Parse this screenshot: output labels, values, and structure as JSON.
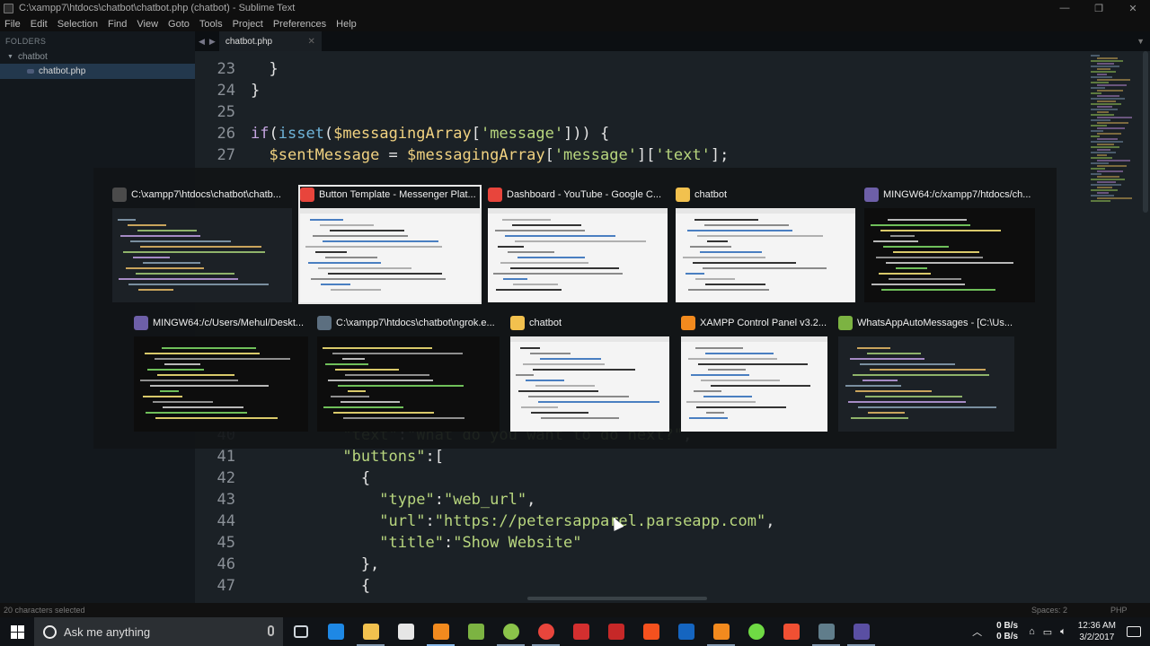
{
  "window": {
    "title": "C:\\xampp7\\htdocs\\chatbot\\chatbot.php (chatbot) - Sublime Text",
    "controls": [
      "—",
      "❐",
      "✕"
    ]
  },
  "menu": [
    "File",
    "Edit",
    "Selection",
    "Find",
    "View",
    "Goto",
    "Tools",
    "Project",
    "Preferences",
    "Help"
  ],
  "sidebar": {
    "heading": "FOLDERS",
    "folder": "chatbot",
    "file": "chatbot.php"
  },
  "tabs": [
    {
      "label": "chatbot.php",
      "close": "✕"
    }
  ],
  "editor": {
    "lines": [
      {
        "n": "23",
        "code": "  }"
      },
      {
        "n": "24",
        "code": "}"
      },
      {
        "n": "25",
        "code": ""
      },
      {
        "n": "26",
        "code": "if(isset($messagingArray['message'])) {"
      },
      {
        "n": "27",
        "code": "  $sentMessage = $messagingArray['message']['text'];"
      },
      {
        "n": "40",
        "code": "          \"text\":\"What do you want to do next?\","
      },
      {
        "n": "41",
        "code": "          \"buttons\":["
      },
      {
        "n": "42",
        "code": "            {"
      },
      {
        "n": "43",
        "code": "              \"type\":\"web_url\","
      },
      {
        "n": "44",
        "code": "              \"url\":\"https://petersapparel.parseapp.com\","
      },
      {
        "n": "45",
        "code": "              \"title\":\"Show Website\""
      },
      {
        "n": "46",
        "code": "            },"
      },
      {
        "n": "47",
        "code": "            {"
      }
    ]
  },
  "status": {
    "selection": "20 characters selected",
    "indent": "Spaces: 2",
    "syntax": "PHP"
  },
  "switcher": {
    "windows": [
      {
        "title": "C:\\xampp7\\htdocs\\chatbot\\chatb...",
        "icon": "sublime-icon",
        "color": "#4b4b4b",
        "kind": "dark",
        "selected": false
      },
      {
        "title": "Button Template - Messenger Plat...",
        "icon": "chrome-icon",
        "color": "#e8453c",
        "kind": "light",
        "selected": true
      },
      {
        "title": "Dashboard - YouTube - Google C...",
        "icon": "chrome-icon",
        "color": "#e8453c",
        "kind": "light",
        "selected": false
      },
      {
        "title": "chatbot",
        "icon": "folder-icon",
        "color": "#f2c14e",
        "kind": "light",
        "selected": false
      },
      {
        "title": "MINGW64:/c/xampp7/htdocs/ch...",
        "icon": "git-bash-icon",
        "color": "#6d5fa8",
        "kind": "term",
        "selected": false
      },
      {
        "title": "MINGW64:/c/Users/Mehul/Deskt...",
        "icon": "git-bash-icon",
        "color": "#6d5fa8",
        "kind": "term",
        "selected": false
      },
      {
        "title": "C:\\xampp7\\htdocs\\chatbot\\ngrok.e...",
        "icon": "console-icon",
        "color": "#5c6f80",
        "kind": "term",
        "selected": false
      },
      {
        "title": "chatbot",
        "icon": "folder-icon",
        "color": "#f2c14e",
        "kind": "light",
        "selected": false
      },
      {
        "title": "XAMPP Control Panel v3.2...",
        "icon": "xampp-icon",
        "color": "#f28a1e",
        "kind": "light",
        "selected": false
      },
      {
        "title": "WhatsAppAutoMessages - [C:\\Us...",
        "icon": "android-studio-icon",
        "color": "#7cb342",
        "kind": "dark",
        "selected": false
      }
    ]
  },
  "taskbar": {
    "search_placeholder": "Ask me anything",
    "apps": [
      {
        "name": "task-view-icon",
        "color": "#cfd6dc",
        "state": ""
      },
      {
        "name": "edge-icon",
        "color": "#1e88e5",
        "state": ""
      },
      {
        "name": "file-explorer-icon",
        "color": "#f2c14e",
        "state": "open"
      },
      {
        "name": "store-icon",
        "color": "#e6e6e6",
        "state": ""
      },
      {
        "name": "sublime-text-icon",
        "color": "#f28a1e",
        "state": "active"
      },
      {
        "name": "notepad-icon",
        "color": "#7cb342",
        "state": ""
      },
      {
        "name": "android-icon",
        "color": "#8bc34a",
        "state": "open"
      },
      {
        "name": "chrome-icon",
        "color": "#e8453c",
        "state": "open"
      },
      {
        "name": "acrobat-icon",
        "color": "#d32f2f",
        "state": ""
      },
      {
        "name": "filezilla-icon",
        "color": "#c62828",
        "state": ""
      },
      {
        "name": "office-icon",
        "color": "#f4511e",
        "state": ""
      },
      {
        "name": "photoshop-icon",
        "color": "#1565c0",
        "state": ""
      },
      {
        "name": "xampp-icon",
        "color": "#f28a1e",
        "state": "open"
      },
      {
        "name": "upwork-icon",
        "color": "#6fda44",
        "state": ""
      },
      {
        "name": "git-icon",
        "color": "#f05033",
        "state": ""
      },
      {
        "name": "console-icon",
        "color": "#607d8b",
        "state": "open"
      },
      {
        "name": "git-bash-icon",
        "color": "#5a4fa3",
        "state": "open"
      }
    ],
    "tray": {
      "net_up": "0 B/s",
      "net_down": "0 B/s",
      "time": "12:36 AM",
      "date": "3/2/2017"
    }
  }
}
